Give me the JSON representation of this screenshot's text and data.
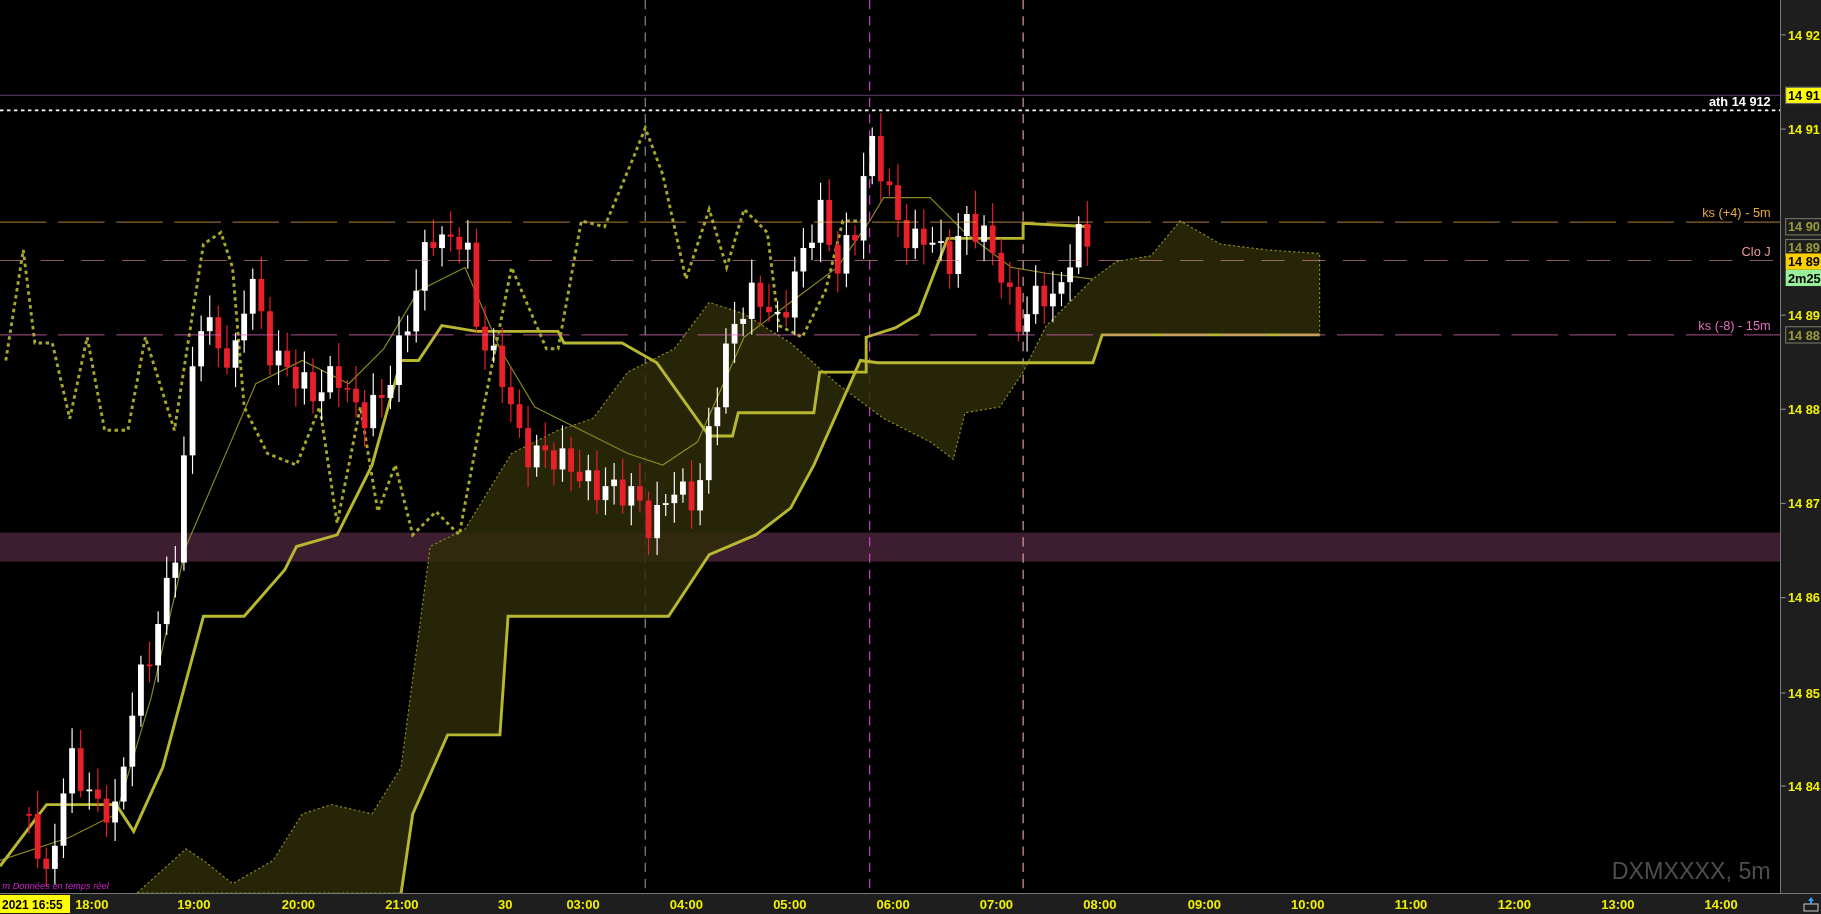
{
  "chart": {
    "symbol": "DXMXXXX, 5m",
    "status": "m Données en temps réel",
    "level_lines": [
      {
        "label": "ath 14 912",
        "color": "#ffffff"
      },
      {
        "label": "ks (+4) - 5m",
        "color": "#e8a848"
      },
      {
        "label": "Clo J",
        "color": "#e89898"
      },
      {
        "label": "ks (-8) - 15m",
        "color": "#e070c0"
      }
    ]
  },
  "price_axis": [
    {
      "text": "14 92",
      "kind": "tick"
    },
    {
      "text": "14 91",
      "kind": "highlight"
    },
    {
      "text": "14 91",
      "kind": "tick"
    },
    {
      "text": "14 90",
      "kind": "boxed"
    },
    {
      "text": "14 89",
      "kind": "boxed"
    },
    {
      "text": "14 89",
      "kind": "current"
    },
    {
      "text": "2m25",
      "kind": "timer"
    },
    {
      "text": "14 89",
      "kind": "tick"
    },
    {
      "text": "14 88",
      "kind": "boxed"
    },
    {
      "text": "14 88",
      "kind": "tick"
    },
    {
      "text": "14 87",
      "kind": "tick"
    },
    {
      "text": "14 86",
      "kind": "tick"
    },
    {
      "text": "14 85",
      "kind": "tick"
    },
    {
      "text": "14 84",
      "kind": "tick"
    }
  ],
  "time_axis": {
    "current": "2021 16:55",
    "labels": [
      "18:00",
      "19:00",
      "20:00",
      "21:00",
      "30",
      "03:00",
      "04:00",
      "05:00",
      "06:00",
      "07:00",
      "08:00",
      "09:00",
      "10:00",
      "11:00",
      "12:00",
      "13:00",
      "14:00"
    ]
  }
}
